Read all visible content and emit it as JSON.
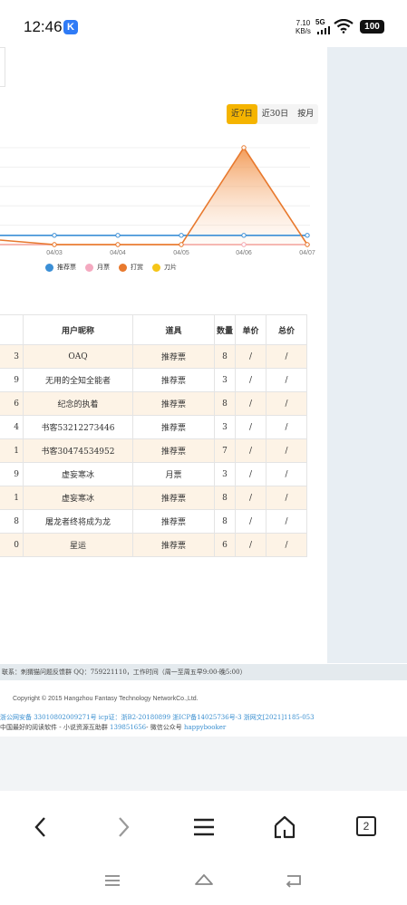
{
  "status": {
    "time": "12:46",
    "app_badge": "K",
    "net_speed_value": "7.10",
    "net_speed_unit": "KB/s",
    "signal": "5G",
    "battery": "100"
  },
  "tabs": [
    {
      "label": "近7日",
      "active": true
    },
    {
      "label": "近30日",
      "active": false
    },
    {
      "label": "按月",
      "active": false
    }
  ],
  "chart_data": {
    "type": "line",
    "x": [
      "04/03",
      "04/04",
      "04/05",
      "04/06",
      "04/07"
    ],
    "series": [
      {
        "name": "推荐票",
        "color": "#3b8fd6",
        "values": [
          1,
          1,
          1,
          1,
          1
        ]
      },
      {
        "name": "月票",
        "color": "#f4a9c0",
        "values": [
          0,
          0,
          0,
          0,
          0
        ]
      },
      {
        "name": "打赏",
        "color": "#e8792e",
        "values": [
          0,
          0,
          0,
          13,
          0
        ]
      },
      {
        "name": "刀片",
        "color": "#f5c518",
        "values": [
          0,
          0,
          0,
          0,
          0
        ]
      }
    ]
  },
  "table": {
    "headers": [
      "",
      "用户昵称",
      "道具",
      "数量",
      "单价",
      "总价"
    ],
    "rows": [
      [
        "3",
        "OAQ",
        "推荐票",
        "8",
        "/",
        "/"
      ],
      [
        "9",
        "无用的全知全能者",
        "推荐票",
        "3",
        "/",
        "/"
      ],
      [
        "6",
        "纪念的执着",
        "推荐票",
        "8",
        "/",
        "/"
      ],
      [
        "4",
        "书客53212273446",
        "推荐票",
        "3",
        "/",
        "/"
      ],
      [
        "1",
        "书客30474534952",
        "推荐票",
        "7",
        "/",
        "/"
      ],
      [
        "9",
        "虚妄寒冰",
        "月票",
        "3",
        "/",
        "/"
      ],
      [
        "1",
        "虚妄寒冰",
        "推荐票",
        "8",
        "/",
        "/"
      ],
      [
        "8",
        "屠龙者终将成为龙",
        "推荐票",
        "8",
        "/",
        "/"
      ],
      [
        "0",
        "星运",
        "推荐票",
        "6",
        "/",
        "/"
      ]
    ]
  },
  "footer": {
    "contact": "联系：刺猬猫问题反馈群 QQ：759221110，工作时间（周一至周五早9:00-晚5:00）",
    "copyright": "Copyright © 2015 Hangzhou Fantasy Technology NetworkCo.,Ltd.",
    "icp": "浙公网安备 33010802009271号  icp证：浙B2-20180899  浙ICP备14025736号-3  浙网文[2021]1185-053",
    "slogan": "中国最好的阅读软件 - 小说资源互助群 ",
    "slogan_link": "139851656",
    "slogan_tail": "- 微信公众号 ",
    "wechat": "happybooker"
  },
  "browser_nav": {
    "tab_count": "2"
  }
}
